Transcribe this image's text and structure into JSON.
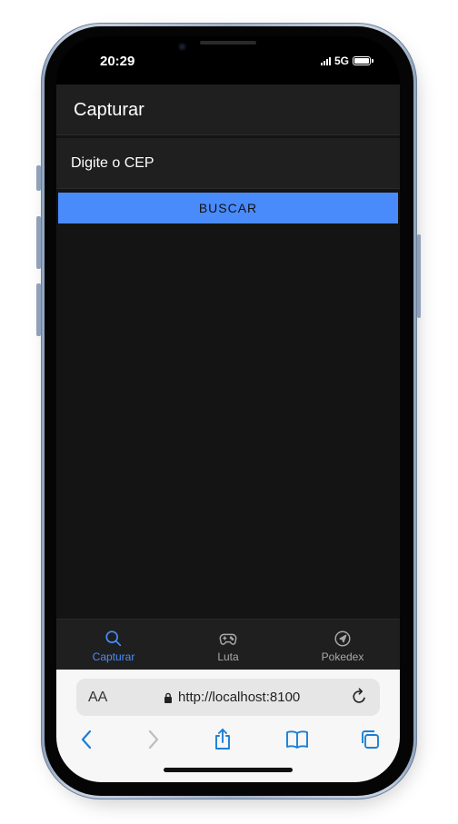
{
  "status_bar": {
    "time": "20:29",
    "network": "5G"
  },
  "header": {
    "title": "Capturar"
  },
  "form": {
    "cep_placeholder": "Digite o CEP",
    "search_button": "BUSCAR"
  },
  "tabs": [
    {
      "label": "Capturar",
      "icon": "search-icon",
      "active": true
    },
    {
      "label": "Luta",
      "icon": "gamepad-icon",
      "active": false
    },
    {
      "label": "Pokedex",
      "icon": "navigate-icon",
      "active": false
    }
  ],
  "safari": {
    "text_size_label": "AA",
    "url": "http://localhost:8100"
  },
  "colors": {
    "accent": "#4a8bfc",
    "background": "#141414",
    "toolbar": "#1f1f1f",
    "safari_blue": "#1a7fd6"
  }
}
